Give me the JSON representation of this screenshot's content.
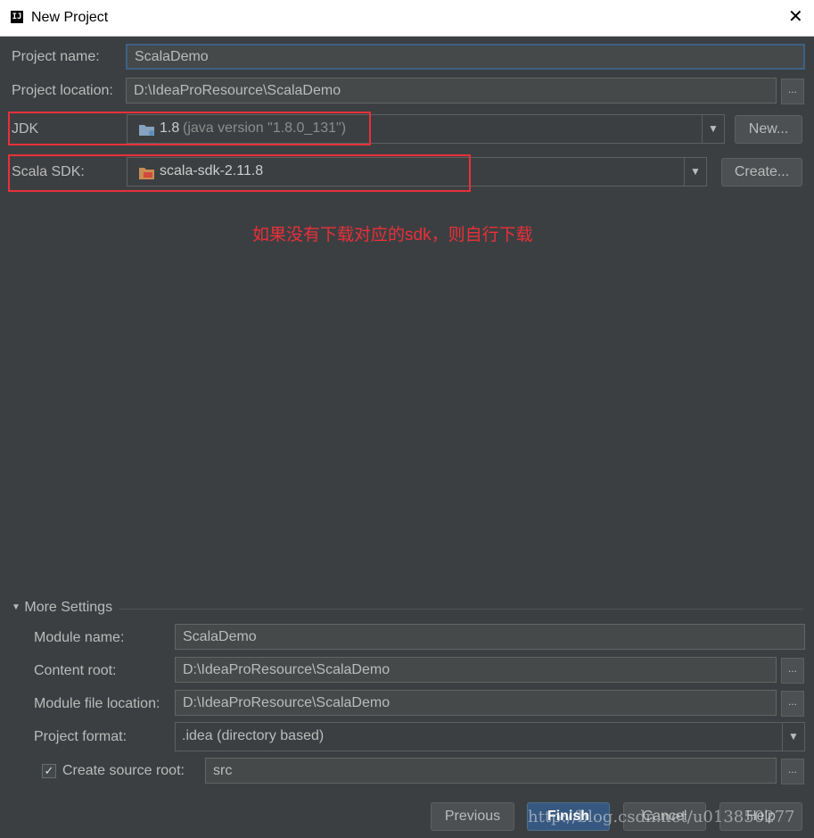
{
  "window": {
    "title": "New Project",
    "app_icon": "IJ",
    "close_glyph": "✕"
  },
  "project": {
    "name_label": "Project name:",
    "name_value": "ScalaDemo",
    "location_label": "Project location:",
    "location_value": "D:\\IdeaProResource\\ScalaDemo",
    "browse": "..."
  },
  "jdk": {
    "label": "JDK",
    "version": "1.8",
    "detail": "(java version \"1.8.0_131\")",
    "new_button": "New..."
  },
  "scala_sdk": {
    "label": "Scala SDK:",
    "value": "scala-sdk-2.11.8",
    "create_button": "Create..."
  },
  "annotation": "如果没有下载对应的sdk，则自行下载",
  "more_settings": {
    "title": "More Settings",
    "module_name_label": "Module name:",
    "module_name_value": "ScalaDemo",
    "content_root_label": "Content root:",
    "content_root_value": "D:\\IdeaProResource\\ScalaDemo",
    "module_file_label": "Module file location:",
    "module_file_value": "D:\\IdeaProResource\\ScalaDemo",
    "format_label": "Project format:",
    "format_value": ".idea (directory based)",
    "source_root_label": "Create source root:",
    "source_root_checked": true,
    "source_root_value": "src"
  },
  "footer": {
    "previous": "Previous",
    "finish": "Finish",
    "cancel": "Cancel",
    "help": "Help"
  },
  "watermark": "http://blog.csdn.net/u013850277",
  "colors": {
    "accent": "#365880",
    "annotation_red": "#e8303a",
    "background": "#3c3f41"
  }
}
